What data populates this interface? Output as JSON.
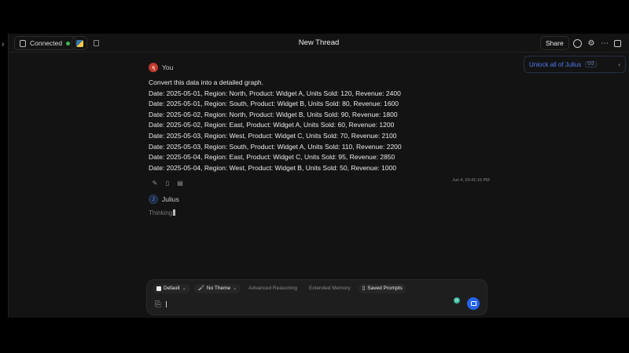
{
  "header": {
    "title": "New Thread",
    "connection_label": "Connected",
    "share_label": "Share",
    "connection_status_color": "#3fb950"
  },
  "unlock": {
    "label": "Unlock all of Julius",
    "badge": "0/3"
  },
  "user_message": {
    "author": "You",
    "lines": [
      "Convert this data into a detailed graph.",
      "Date: 2025-05-01, Region: North, Product: Widget A, Units Sold: 120, Revenue: 2400",
      "Date: 2025-05-01, Region: South, Product: Widget B, Units Sold: 80, Revenue: 1600",
      "Date: 2025-05-02, Region: North, Product: Widget B, Units Sold: 90, Revenue: 1800",
      "Date: 2025-05-02, Region: East, Product: Widget A, Units Sold: 60, Revenue: 1200",
      "Date: 2025-05-03, Region: West, Product: Widget C, Units Sold: 70, Revenue: 2100",
      "Date: 2025-05-03, Region: South, Product: Widget A, Units Sold: 110, Revenue: 2200",
      "Date: 2025-05-04, Region: East, Product: Widget C, Units Sold: 95, Revenue: 2850",
      "Date: 2025-05-04, Region: West, Product: Widget B, Units Sold: 50, Revenue: 1000"
    ],
    "timestamp": "Jun 4, 03:41:16 PM"
  },
  "assistant": {
    "name": "Julius",
    "status": "Thinking"
  },
  "composer": {
    "pills": {
      "model": "Default",
      "theme": "No Theme",
      "reasoning": "Advanced Reasoning",
      "memory": "Extended Memory",
      "prompts": "Saved Prompts"
    },
    "placeholder": ""
  },
  "icons": {
    "sidebar_toggle": "chevron-right-icon",
    "database": "database-icon",
    "python": "python-icon",
    "copy": "copy-icon",
    "history": "history-icon",
    "settings": "gear-icon",
    "more": "more-icon",
    "panel": "panel-icon",
    "edit": "pencil-icon",
    "bookmark": "bookmark-icon",
    "clipboard": "clipboard-icon",
    "attach": "paperclip-icon",
    "send": "send-icon"
  },
  "colors": {
    "accent": "#2563eb",
    "link": "#4f7cf5",
    "user_avatar": "#c0392b"
  }
}
